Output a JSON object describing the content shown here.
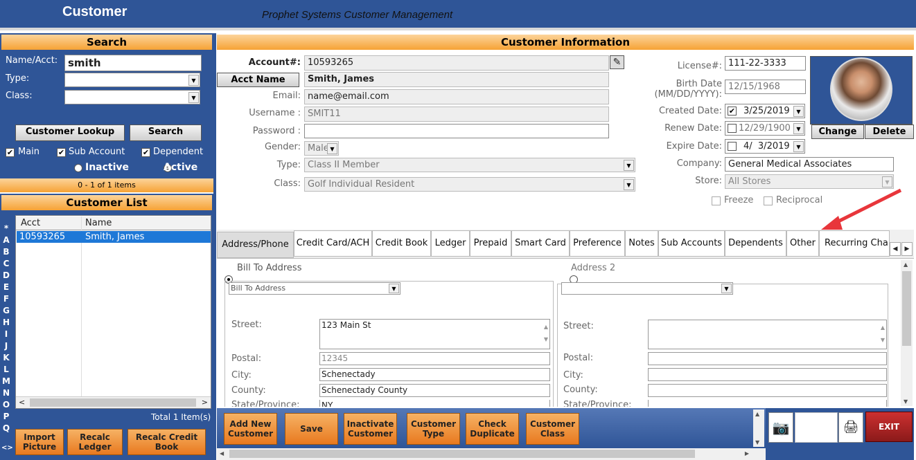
{
  "window": {
    "title": "Customer",
    "subtitle": "Prophet Systems Customer Management"
  },
  "search": {
    "header": "Search",
    "name_acct_label": "Name/Acct:",
    "name_acct_value": "smith",
    "type_label": "Type:",
    "class_label": "Class:",
    "lookup_label": "Customer Lookup",
    "search_label": "Search",
    "main_label": "Main",
    "sub_account_label": "Sub Account",
    "dependent_label": "Dependent",
    "inactive_label": "Inactive",
    "active_label": "Active",
    "items_count": "0 - 1 of 1 items"
  },
  "customer_list": {
    "header": "Customer List",
    "col_acct": "Acct",
    "col_name": "Name",
    "rows": [
      {
        "acct": "10593265",
        "name": "Smith, James"
      }
    ],
    "total": "Total 1 Item(s)",
    "letters": [
      "*",
      "A",
      "B",
      "C",
      "D",
      "E",
      "F",
      "G",
      "H",
      "I",
      "J",
      "K",
      "L",
      "M",
      "N",
      "O",
      "P",
      "Q"
    ]
  },
  "left_buttons": {
    "import": "Import Picture",
    "recalc_ledger": "Recalc Ledger",
    "recalc_book": "Recalc Credit Book"
  },
  "info": {
    "header": "Customer Information",
    "account_label": "Account#:",
    "account_value": "10593265",
    "acct_name_label": "Acct Name",
    "acct_name_value": "Smith, James",
    "email_label": "Email:",
    "email_value": "name@email.com",
    "username_label": "Username :",
    "username_value": "SMIT11",
    "password_label": "Password :",
    "password_value": "",
    "gender_label": "Gender:",
    "gender_value": "Male",
    "type_label": "Type:",
    "type_value": "Class II Member",
    "class_label": "Class:",
    "class_value": "Golf Individual Resident",
    "license_label": "License#:",
    "license_value": "111-22-3333",
    "birth_label_1": "Birth Date",
    "birth_label_2": "(MM/DD/YYYY):",
    "birth_value": "12/15/1968",
    "created_label": "Created Date:",
    "created_value": "3/25/2019",
    "renew_label": "Renew Date:",
    "renew_value": "12/29/1900",
    "expire_label": "Expire Date:",
    "expire_value": "4/  3/2019",
    "company_label": "Company:",
    "company_value": "General Medical Associates",
    "store_label": "Store:",
    "store_value": "All Stores",
    "freeze_label": "Freeze",
    "reciprocal_label": "Reciprocal",
    "change_label": "Change",
    "delete_label": "Delete"
  },
  "tabs": [
    "Address/Phone",
    "Credit Card/ACH",
    "Credit Book",
    "Ledger",
    "Prepaid",
    "Smart Card",
    "Preference",
    "Notes",
    "Sub Accounts",
    "Dependents",
    "Other",
    "Recurring Char"
  ],
  "address": {
    "bill_to_label": "Bill To Address",
    "address2_label": "Address 2",
    "bill_to_select": "Bill To Address",
    "street_label": "Street:",
    "postal_label": "Postal:",
    "city_label": "City:",
    "county_label": "County:",
    "state_label": "State/Province:",
    "street_value": "123 Main St",
    "postal_value": "12345",
    "city_value": "Schenectady",
    "county_value": "Schenectady County",
    "state_value": "NY"
  },
  "bottom_buttons": [
    "Add New Customer",
    "Save",
    "Inactivate Customer",
    "Customer Type",
    "Check Duplicate",
    "Customer Class"
  ],
  "exit_label": "EXIT",
  "colors": {
    "blue": "#2f5597",
    "orange": "#f6a235",
    "exit": "#b22222",
    "arrow": "#e8363b"
  }
}
